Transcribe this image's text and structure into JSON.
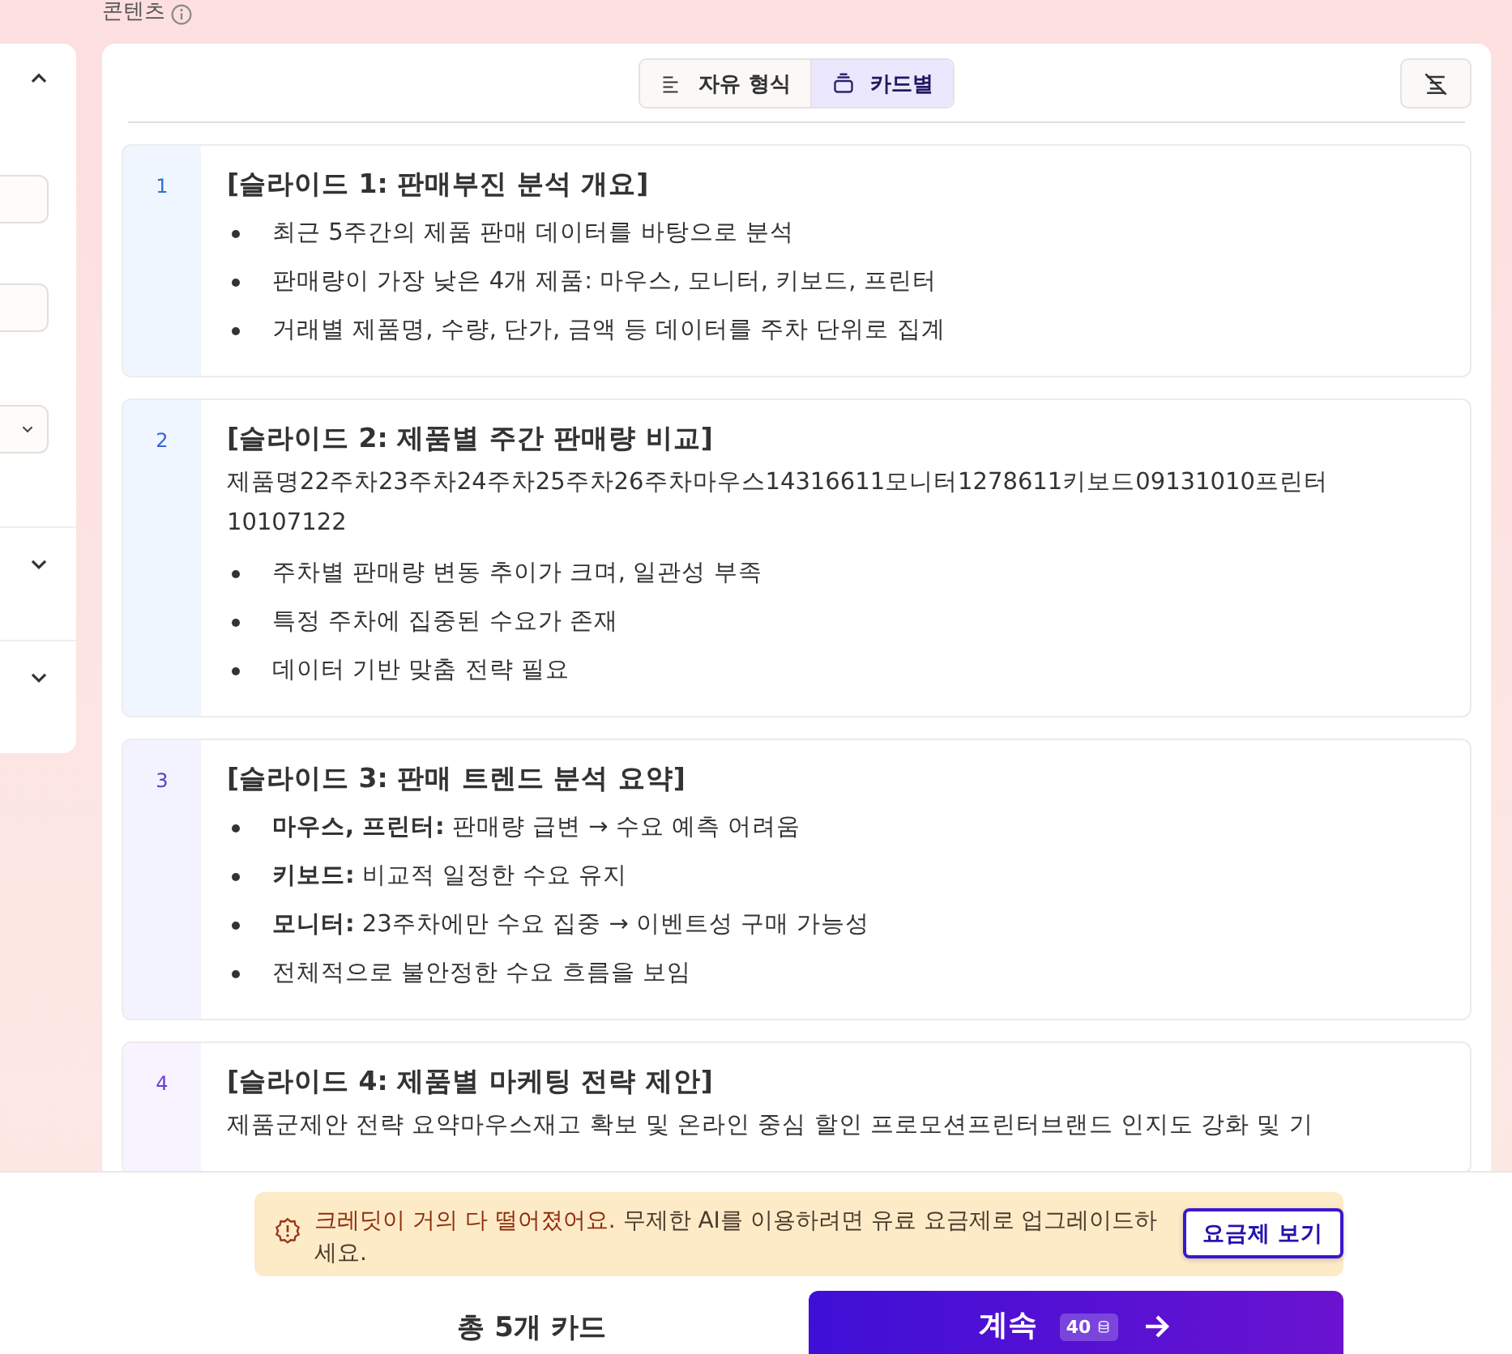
{
  "section_label": "콘텐츠",
  "side_panel": {
    "sections": [
      {
        "expanded": true,
        "fields": [
          {
            "kind": "text"
          },
          {
            "kind": "text"
          },
          {
            "kind": "select"
          }
        ]
      },
      {
        "expanded": false
      },
      {
        "expanded": false
      }
    ]
  },
  "view_toggle": [
    {
      "label": "자유 형식",
      "kind": "freeform",
      "selected": false
    },
    {
      "label": "카드별",
      "kind": "cards",
      "selected": true
    }
  ],
  "cards": [
    {
      "number": "1",
      "title": "[슬라이드 1: 판매부진 분석 개요]",
      "blocks": [
        {
          "kind": "bullets",
          "items": [
            "최근 5주간의 제품 판매 데이터를 바탕으로 분석",
            "판매량이 가장 낮은 4개 제품: 마우스, 모니터, 키보드, 프린터",
            "거래별 제품명, 수량, 단가, 금액 등 데이터를 주차 단위로 집계"
          ]
        }
      ]
    },
    {
      "number": "2",
      "title": "[슬라이드 2: 제품별 주간 판매량 비교]",
      "blocks": [
        {
          "kind": "paragraph",
          "text": "제품명22주차23주차24주차25주차26주차마우스14316611모니터1278611키보드09131010프린터10107122"
        },
        {
          "kind": "bullets",
          "items": [
            "주차별 판매량 변동 추이가 크며, 일관성 부족",
            "특정 주차에 집중된 수요가 존재",
            "데이터 기반 맞춤 전략 필요"
          ]
        }
      ]
    },
    {
      "number": "3",
      "title": "[슬라이드 3: 판매 트렌드 분석 요약]",
      "blocks": [
        {
          "kind": "bullets",
          "items": [
            "**마우스, 프린터:** 판매량 급변 → 수요 예측 어려움",
            "**키보드:** 비교적 일정한 수요 유지",
            "**모니터:** 23주차에만 수요 집중 → 이벤트성 구매 가능성",
            "전체적으로 불안정한 수요 흐름을 보임"
          ]
        }
      ]
    },
    {
      "number": "4",
      "title": "[슬라이드 4: 제품별 마케팅 전략 제안]",
      "blocks": [
        {
          "kind": "paragraph",
          "text": "제품군제안 전략 요약마우스재고 확보 및 온라인 중심 할인 프로모션프린터브랜드 인지도 강화 및 기"
        }
      ]
    }
  ],
  "notice": {
    "text": "**크레딧이 거의 다 떨어졌어요.** 무제한 AI를 이용하려면 유료 요금제로 업그레이드하세요.",
    "button": "요금제 보기"
  },
  "footer": {
    "card_count": "총 5개 카드",
    "continue_button": {
      "label": "계속",
      "credits": "40"
    }
  }
}
